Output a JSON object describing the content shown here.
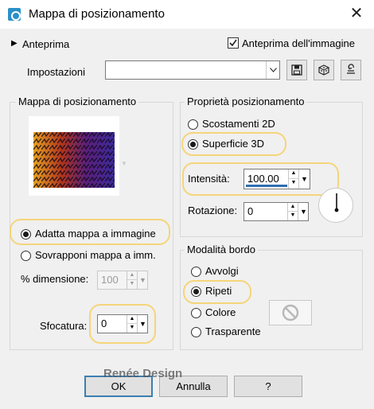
{
  "window": {
    "title": "Mappa di posizionamento",
    "close_glyph": "✕"
  },
  "top": {
    "preview_toggle_label": "Anteprima",
    "image_preview_label": "Anteprima dell'immagine",
    "image_preview_checked": true,
    "settings_label": "Impostazioni",
    "settings_value": ""
  },
  "map_group": {
    "title": "Mappa di posizionamento",
    "fit_map_label": "Adatta mappa a immagine",
    "fit_map_selected": true,
    "overlay_map_label": "Sovrapponi mappa a imm.",
    "size_label": "% dimensione:",
    "size_value": "100",
    "blur_label": "Sfocatura:",
    "blur_value": "0"
  },
  "position_group": {
    "title": "Proprietà posizionamento",
    "offsets_label": "Scostamenti 2D",
    "surface_label": "Superficie 3D",
    "surface_selected": true,
    "intensity_label": "Intensità:",
    "intensity_value": "100.00",
    "rotation_label": "Rotazione:",
    "rotation_value": "0"
  },
  "edge_group": {
    "title": "Modalità bordo",
    "wrap_label": "Avvolgi",
    "repeat_label": "Ripeti",
    "repeat_selected": true,
    "color_label": "Colore",
    "transparent_label": "Trasparente"
  },
  "buttons": {
    "ok": "OK",
    "cancel": "Annulla",
    "help": "?"
  },
  "watermark": "Renée Design",
  "colors": {
    "accent": "#2f6fb3",
    "highlight": "#f5d57a"
  }
}
